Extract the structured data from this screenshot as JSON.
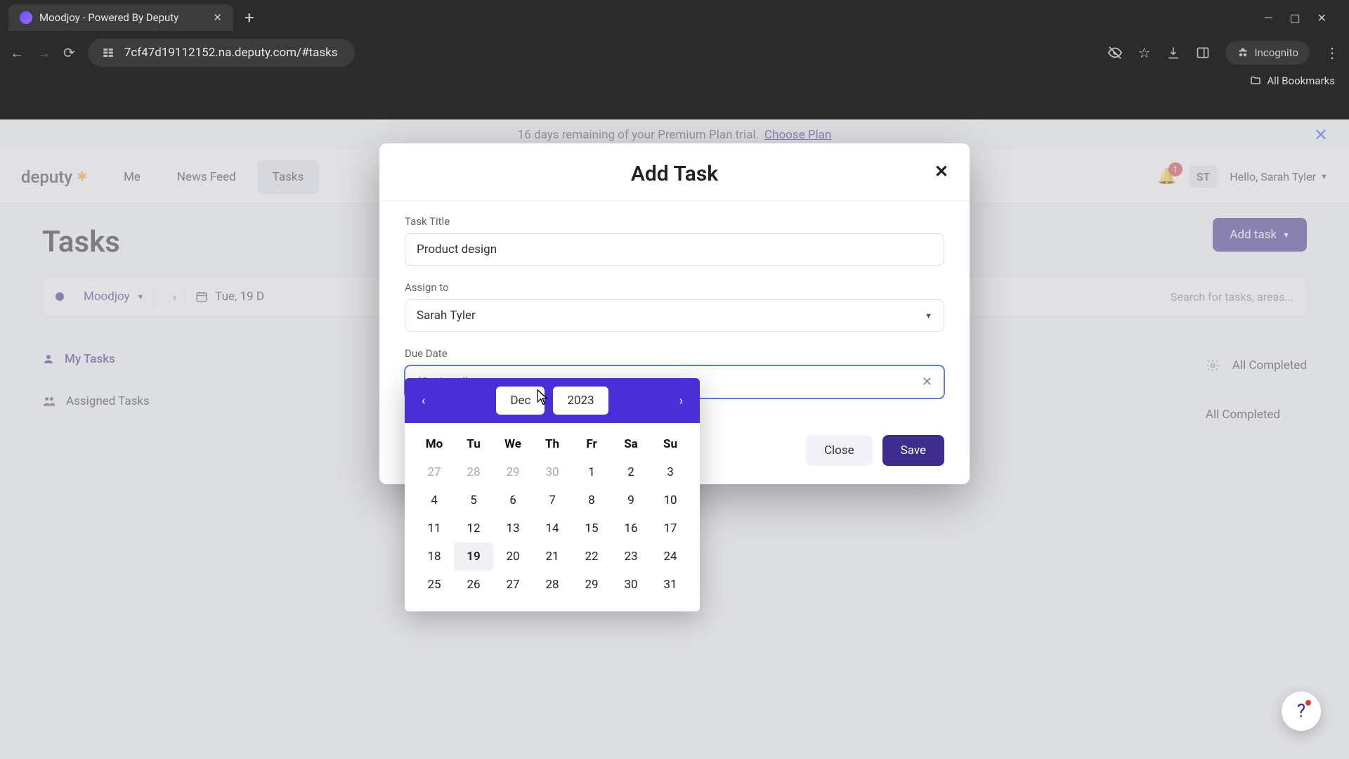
{
  "browser": {
    "tab_title": "Moodjoy - Powered By Deputy",
    "url": "7cf47d19112152.na.deputy.com/#tasks",
    "incognito_label": "Incognito",
    "bookmarks_label": "All Bookmarks"
  },
  "banner": {
    "text": "16 days remaining of your Premium Plan trial.",
    "link": "Choose Plan"
  },
  "header": {
    "logo": "deputy",
    "tabs": [
      "Me",
      "News Feed",
      "Tasks"
    ],
    "active_tab_index": 2,
    "notifications": "1",
    "avatar_initials": "ST",
    "greeting": "Hello, Sarah Tyler"
  },
  "page": {
    "title": "Tasks",
    "add_task_button": "Add task",
    "filter_location": "Moodjoy",
    "filter_date": "Tue, 19 D",
    "search_placeholder": "Search for tasks, areas...",
    "side_items": [
      "My Tasks",
      "Assigned Tasks"
    ],
    "completed_label": "All Completed"
  },
  "modal": {
    "title": "Add Task",
    "task_title_label": "Task Title",
    "task_title_value": "Product design",
    "assign_label": "Assign to",
    "assign_value": "Sarah Tyler",
    "due_label": "Due Date",
    "due_placeholder": "(Optional)",
    "close_button": "Close",
    "save_button": "Save"
  },
  "calendar": {
    "month": "Dec",
    "year": "2023",
    "dows": [
      "Mo",
      "Tu",
      "We",
      "Th",
      "Fr",
      "Sa",
      "Su"
    ],
    "weeks": [
      [
        {
          "d": "27",
          "m": true
        },
        {
          "d": "28",
          "m": true
        },
        {
          "d": "29",
          "m": true
        },
        {
          "d": "30",
          "m": true
        },
        {
          "d": "1"
        },
        {
          "d": "2"
        },
        {
          "d": "3"
        }
      ],
      [
        {
          "d": "4"
        },
        {
          "d": "5"
        },
        {
          "d": "6"
        },
        {
          "d": "7"
        },
        {
          "d": "8"
        },
        {
          "d": "9"
        },
        {
          "d": "10"
        }
      ],
      [
        {
          "d": "11"
        },
        {
          "d": "12"
        },
        {
          "d": "13"
        },
        {
          "d": "14"
        },
        {
          "d": "15"
        },
        {
          "d": "16"
        },
        {
          "d": "17"
        }
      ],
      [
        {
          "d": "18"
        },
        {
          "d": "19",
          "t": true
        },
        {
          "d": "20"
        },
        {
          "d": "21"
        },
        {
          "d": "22"
        },
        {
          "d": "23"
        },
        {
          "d": "24"
        }
      ],
      [
        {
          "d": "25"
        },
        {
          "d": "26"
        },
        {
          "d": "27"
        },
        {
          "d": "28"
        },
        {
          "d": "29"
        },
        {
          "d": "30"
        },
        {
          "d": "31"
        }
      ]
    ]
  },
  "help_fab": "?"
}
